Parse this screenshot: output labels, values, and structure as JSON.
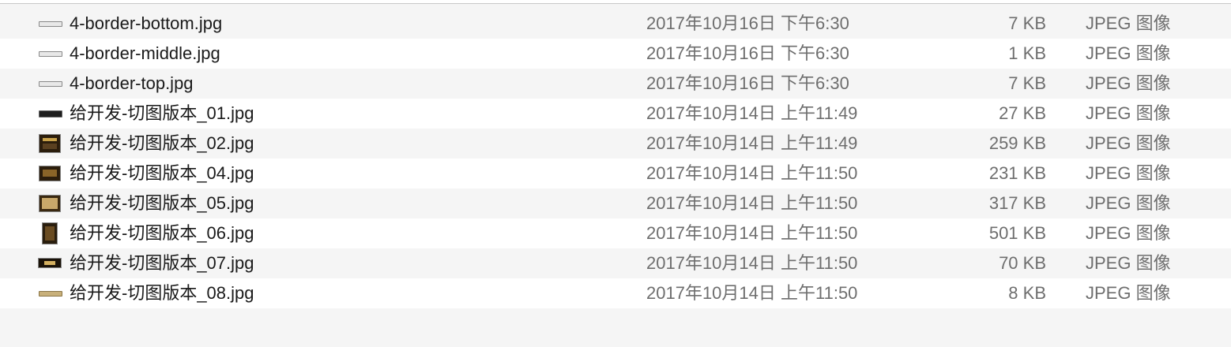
{
  "files": [
    {
      "name": "4-border-bottom.jpg",
      "date": "2017年10月16日 下午6:30",
      "size": "7 KB",
      "kind": "JPEG 图像",
      "icon": "border-strip-thumbnail-icon"
    },
    {
      "name": "4-border-middle.jpg",
      "date": "2017年10月16日 下午6:30",
      "size": "1 KB",
      "kind": "JPEG 图像",
      "icon": "border-strip-thumbnail-icon"
    },
    {
      "name": "4-border-top.jpg",
      "date": "2017年10月16日 下午6:30",
      "size": "7 KB",
      "kind": "JPEG 图像",
      "icon": "border-strip-thumbnail-icon"
    },
    {
      "name": "给开发-切图版本_01.jpg",
      "date": "2017年10月14日 上午11:49",
      "size": "27 KB",
      "kind": "JPEG 图像",
      "icon": "dark-banner-thumbnail-icon"
    },
    {
      "name": "给开发-切图版本_02.jpg",
      "date": "2017年10月14日 上午11:49",
      "size": "259 KB",
      "kind": "JPEG 图像",
      "icon": "image-thumbnail-icon"
    },
    {
      "name": "给开发-切图版本_04.jpg",
      "date": "2017年10月14日 上午11:50",
      "size": "231 KB",
      "kind": "JPEG 图像",
      "icon": "image-thumbnail-icon"
    },
    {
      "name": "给开发-切图版本_05.jpg",
      "date": "2017年10月14日 上午11:50",
      "size": "317 KB",
      "kind": "JPEG 图像",
      "icon": "image-thumbnail-icon"
    },
    {
      "name": "给开发-切图版本_06.jpg",
      "date": "2017年10月14日 上午11:50",
      "size": "501 KB",
      "kind": "JPEG 图像",
      "icon": "portrait-image-thumbnail-icon"
    },
    {
      "name": "给开发-切图版本_07.jpg",
      "date": "2017年10月14日 上午11:50",
      "size": "70 KB",
      "kind": "JPEG 图像",
      "icon": "dark-banner-thumbnail-icon"
    },
    {
      "name": "给开发-切图版本_08.jpg",
      "date": "2017年10月14日 上午11:50",
      "size": "8 KB",
      "kind": "JPEG 图像",
      "icon": "gold-strip-thumbnail-icon"
    }
  ],
  "colors": {
    "row_alt": "#f5f5f5",
    "row_plain": "#ffffff",
    "name_text": "#1a1a1a",
    "meta_text": "#6e6e6e"
  }
}
